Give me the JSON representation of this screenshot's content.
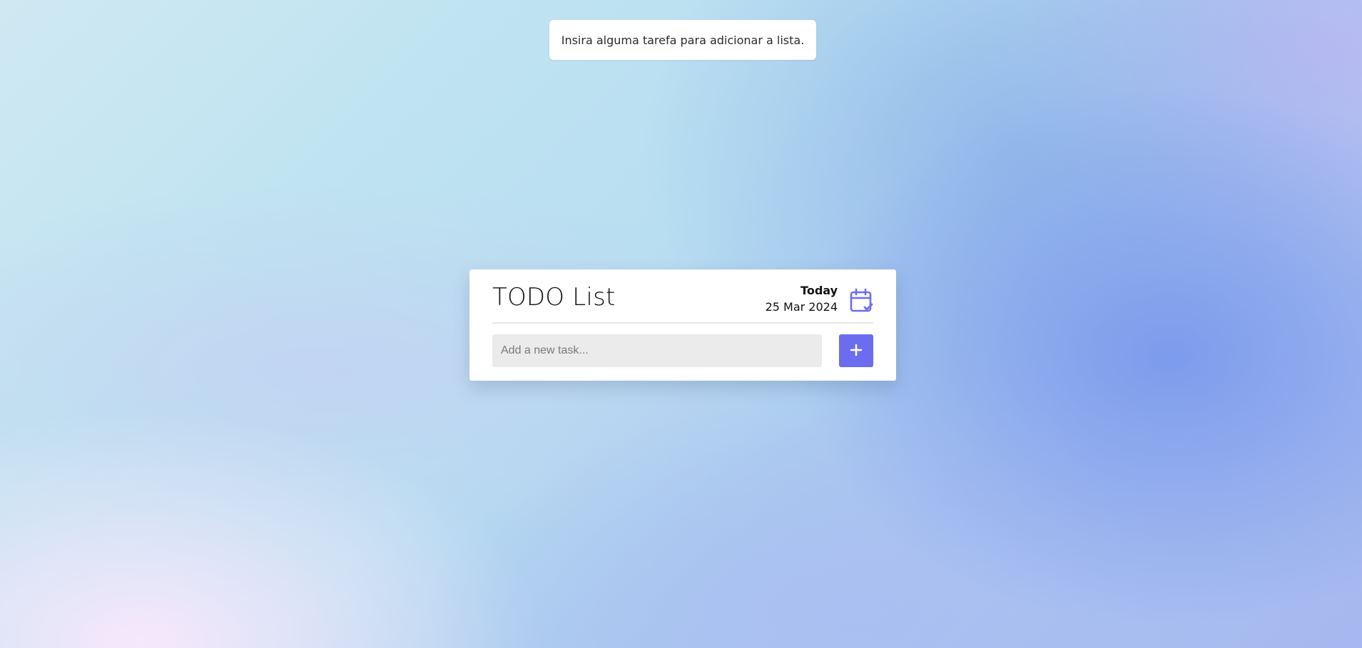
{
  "toast": {
    "message": "Insira alguma tarefa para adicionar a lista."
  },
  "card": {
    "title": "TODO List",
    "date_label": "Today",
    "date_value": "25 Mar 2024",
    "calendar_icon": "calendar-check-icon"
  },
  "task_form": {
    "placeholder": "Add a new task...",
    "value": "",
    "add_button_icon": "plus-icon"
  },
  "colors": {
    "accent": "#6c6cf0",
    "input_background": "#ebebeb",
    "card_background": "#ffffff"
  }
}
